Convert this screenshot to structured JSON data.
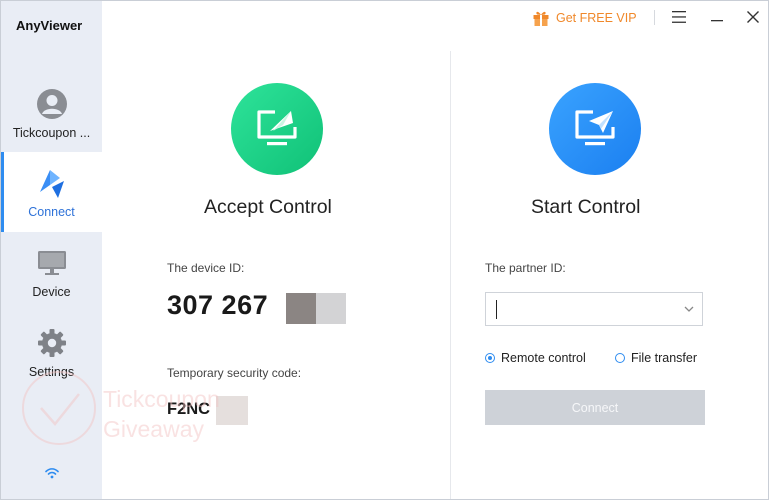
{
  "app": {
    "title": "AnyViewer"
  },
  "titlebar": {
    "vip_label": "Get FREE VIP",
    "icons": [
      "gift-icon",
      "menu-icon",
      "minimize-icon",
      "close-icon"
    ]
  },
  "sidebar": {
    "items": [
      {
        "label": "Tickcoupon ...",
        "icon": "user-avatar-icon"
      },
      {
        "label": "Connect",
        "icon": "connect-icon",
        "active": true
      },
      {
        "label": "Device",
        "icon": "monitor-icon"
      },
      {
        "label": "Settings",
        "icon": "gear-icon"
      }
    ],
    "status_icon": "wifi-icon"
  },
  "accept": {
    "title": "Accept Control",
    "device_id_label": "The device ID:",
    "device_id": "307 267",
    "security_code_label": "Temporary security code:",
    "security_code": "F2NC"
  },
  "start": {
    "title": "Start Control",
    "partner_id_label": "The partner ID:",
    "partner_id_value": "",
    "options": [
      {
        "label": "Remote control",
        "selected": true
      },
      {
        "label": "File transfer",
        "selected": false
      }
    ],
    "connect_label": "Connect"
  },
  "watermark": {
    "line1": "Tickcoupon",
    "line2": "Giveaway"
  },
  "colors": {
    "accent": "#2e8cf0",
    "green": "#1ed28a",
    "blue": "#2a8ff5",
    "vip": "#f0882a",
    "sidebar_bg": "#e9edf5"
  }
}
